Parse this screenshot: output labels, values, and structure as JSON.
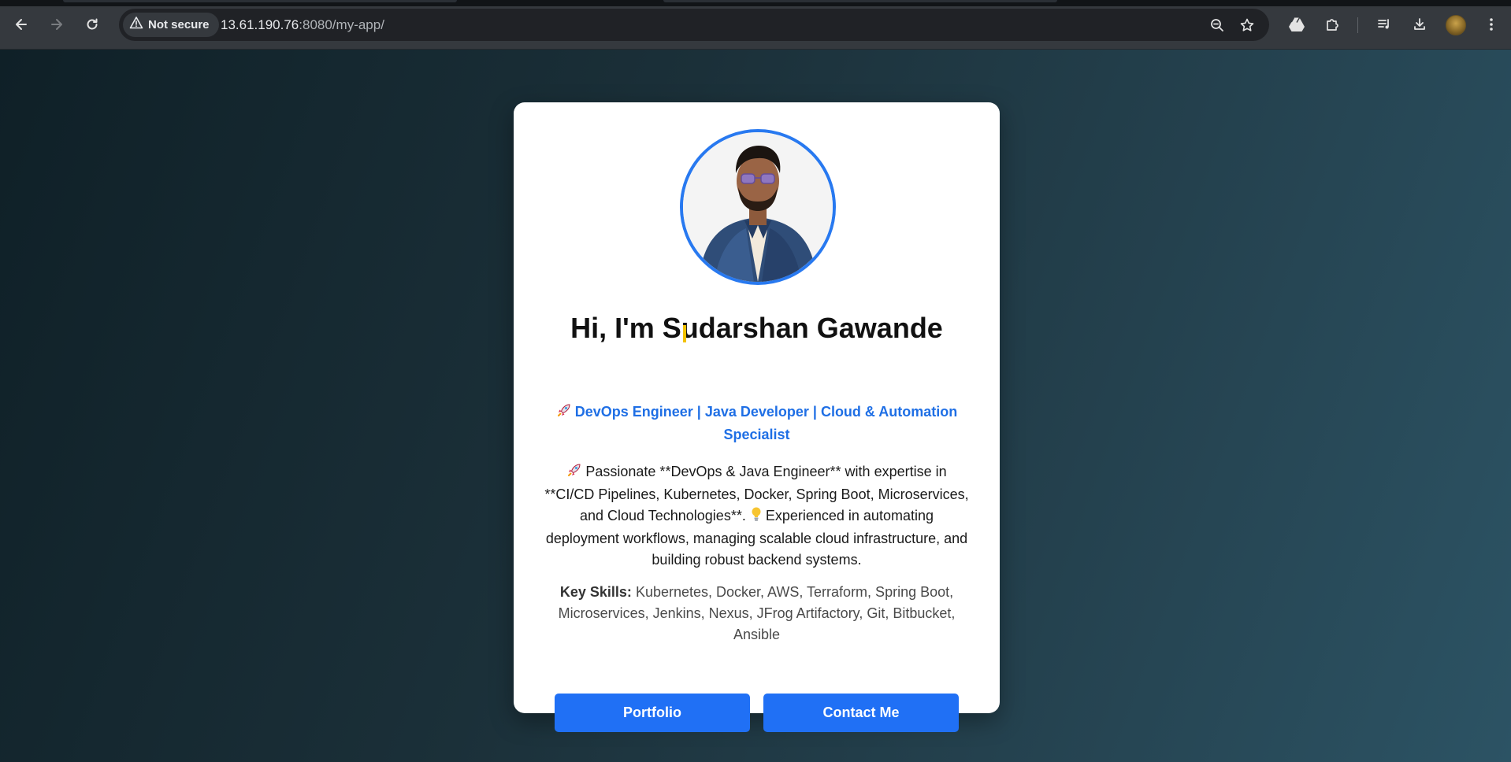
{
  "browser": {
    "security_label": "Not secure",
    "url_host": "13.61.190.76",
    "url_rest": ":8080/my-app/",
    "icons": {
      "back": "arrow-left-icon",
      "forward": "arrow-right-icon",
      "reload": "reload-icon",
      "warning": "warning-triangle-icon",
      "zoom": "zoom-out-icon",
      "bookmark": "star-icon",
      "drive": "google-drive-icon",
      "extensions": "puzzle-icon",
      "media": "media-control-icon",
      "downloads": "download-icon",
      "profile": "profile-avatar",
      "menu": "kebab-menu-icon"
    }
  },
  "profile": {
    "heading": "Hi, I'm Sudarshan Gawande",
    "tagline": "DevOps Engineer | Java Developer | Cloud & Automation Specialist",
    "bio_part1": "Passionate **DevOps & Java Engineer** with expertise in **CI/CD Pipelines, Kubernetes, Docker, Spring Boot, Microservices, and Cloud Technologies**.",
    "bio_part2": "Experienced in automating deployment workflows, managing scalable cloud infrastructure, and building robust backend systems.",
    "skills_label": "Key Skills:",
    "skills_text": "Kubernetes, Docker, AWS, Terraform, Spring Boot, Microservices, Jenkins, Nexus, JFrog Artifactory, Git, Bitbucket, Ansible",
    "portfolio_label": "Portfolio",
    "contact_label": "Contact Me"
  },
  "colors": {
    "accent": "#2070f5",
    "tagline": "#1f6fe5",
    "avatar_border": "#2879f0"
  }
}
